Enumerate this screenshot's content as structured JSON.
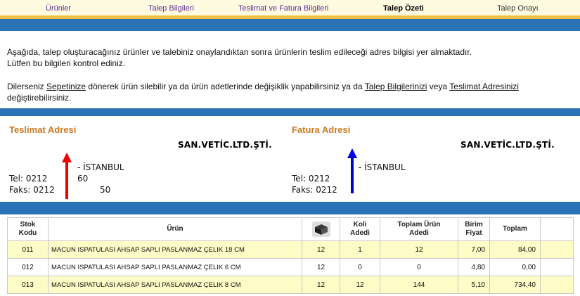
{
  "steps": [
    {
      "label": "Ürünler",
      "state": "link"
    },
    {
      "label": "Talep Bilgileri",
      "state": "link"
    },
    {
      "label": "Teslimat ve Fatura Bilgileri",
      "state": "link"
    },
    {
      "label": "Talep Özeti",
      "state": "active"
    },
    {
      "label": "Talep Onayı",
      "state": "pending"
    }
  ],
  "info": {
    "line1": "Aşağıda, talep oluşturacağınız ürünler ve talebiniz onaylandıktan sonra ürünlerin teslim edileceği adres bilgisi yer almaktadır.",
    "line2": "Lütfen bu bilgileri kontrol ediniz.",
    "line3_prefix": "Dilerseniz ",
    "link_cart": "Sepetinize",
    "line3_mid1": " dönerek ürün silebilir ya da ürün adetlerinde değişiklik yapabilirsiniz ya da ",
    "link_request": "Talep Bilgilerinizi",
    "line3_mid2": " veya ",
    "link_delivery": "Teslimat Adresinizi",
    "line4": "değiştirebilirsiniz."
  },
  "delivery": {
    "title": "Teslimat Adresi",
    "company": "SAN.VETİC.LTD.ŞTİ.",
    "city": "- İSTANBUL",
    "tel_label": "Tel: 0212",
    "tel_suffix": "60",
    "fax_label": "Faks: 0212",
    "fax_suffix": "50"
  },
  "invoice": {
    "title": "Fatura Adresi",
    "company": "SAN.VETİC.LTD.ŞTİ.",
    "city": "- İSTANBUL",
    "tel_label": "Tel: 0212",
    "fax_label": "Faks: 0212"
  },
  "colors": {
    "background": "#2c73b6",
    "accent_orange": "#cc7a1f",
    "row_highlight": "#fdfbc6",
    "arrow_red": "#ee0000",
    "arrow_blue": "#0000dd"
  },
  "table": {
    "headers": {
      "stock_code": "Stok Kodu",
      "product": "Ürün",
      "box_icon": "box-icon",
      "case_qty": "Koli Adedi",
      "total_qty": "Toplam Ürün Adedi",
      "unit_price": "Birim Fiyat",
      "total": "Toplam"
    },
    "rows": [
      {
        "code": "011",
        "name": "MACUN ISPATULASI AHSAP SAPLI PASLANMAZ ÇELIK 18 CM",
        "per_box": "12",
        "cases": "1",
        "qty": "12",
        "price": "7,00",
        "total": "84,00"
      },
      {
        "code": "012",
        "name": "MACUN ISPATULASI AHSAP SAPLI PASLANMAZ ÇELIK 6 CM",
        "per_box": "12",
        "cases": "0",
        "qty": "0",
        "price": "4,80",
        "total": "0,00"
      },
      {
        "code": "013",
        "name": "MACUN ISPATULASI AHSAP SAPLI PASLANMAZ ÇELIK 8 CM",
        "per_box": "12",
        "cases": "12",
        "qty": "144",
        "price": "5,10",
        "total": "734,40"
      }
    ]
  }
}
